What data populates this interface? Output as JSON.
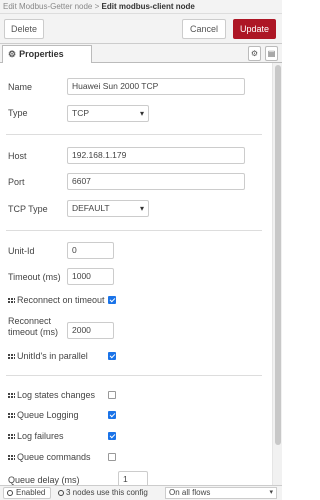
{
  "breadcrumb": {
    "previous": "Edit Modbus-Getter node",
    "separator": " > ",
    "current": "Edit modbus-client node"
  },
  "toolbar": {
    "delete_label": "Delete",
    "cancel_label": "Cancel",
    "update_label": "Update",
    "accent_color": "#ad1625"
  },
  "tabs": {
    "properties_label": "Properties",
    "icons": [
      "gear-icon",
      "description-icon"
    ]
  },
  "form": {
    "name_label": "Name",
    "name_value": "Huawei Sun 2000 TCP",
    "type_label": "Type",
    "type_value": "TCP",
    "host_label": "Host",
    "host_value": "192.168.1.179",
    "port_label": "Port",
    "port_value": "6607",
    "tcp_type_label": "TCP Type",
    "tcp_type_value": "DEFAULT",
    "unit_id_label": "Unit-Id",
    "unit_id_value": "0",
    "timeout_label": "Timeout (ms)",
    "timeout_value": "1000",
    "reconnect_on_timeout_label": "Reconnect on timeout",
    "reconnect_on_timeout_checked": true,
    "reconnect_timeout_label_1": "Reconnect",
    "reconnect_timeout_label_2": "timeout (ms)",
    "reconnect_timeout_value": "2000",
    "unitids_parallel_label": "UnitId's in parallel",
    "unitids_parallel_checked": true,
    "log_state_changes_label": "Log states changes",
    "log_state_changes_checked": false,
    "queue_logging_label": "Queue Logging",
    "queue_logging_checked": true,
    "log_failures_label": "Log failures",
    "log_failures_checked": true,
    "queue_commands_label": "Queue commands",
    "queue_commands_checked": false,
    "queue_delay_label": "Queue delay (ms)",
    "queue_delay_value": "1"
  },
  "footer": {
    "enabled_label": "Enabled",
    "users_label": "3 nodes use this config",
    "flows_select_value": "On all flows"
  }
}
